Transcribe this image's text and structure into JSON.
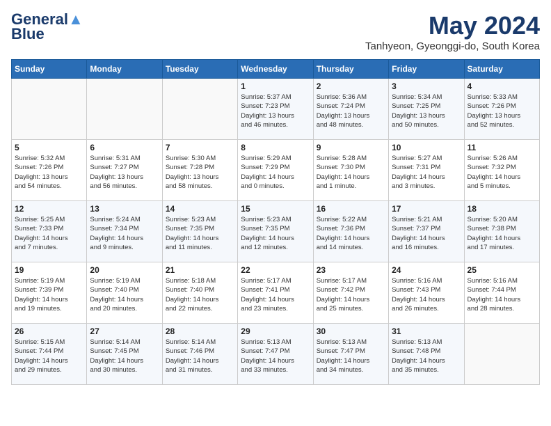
{
  "header": {
    "logo_line1": "General",
    "logo_line2": "Blue",
    "month": "May 2024",
    "location": "Tanhyeon, Gyeonggi-do, South Korea"
  },
  "weekdays": [
    "Sunday",
    "Monday",
    "Tuesday",
    "Wednesday",
    "Thursday",
    "Friday",
    "Saturday"
  ],
  "weeks": [
    [
      {
        "day": "",
        "info": ""
      },
      {
        "day": "",
        "info": ""
      },
      {
        "day": "",
        "info": ""
      },
      {
        "day": "1",
        "info": "Sunrise: 5:37 AM\nSunset: 7:23 PM\nDaylight: 13 hours\nand 46 minutes."
      },
      {
        "day": "2",
        "info": "Sunrise: 5:36 AM\nSunset: 7:24 PM\nDaylight: 13 hours\nand 48 minutes."
      },
      {
        "day": "3",
        "info": "Sunrise: 5:34 AM\nSunset: 7:25 PM\nDaylight: 13 hours\nand 50 minutes."
      },
      {
        "day": "4",
        "info": "Sunrise: 5:33 AM\nSunset: 7:26 PM\nDaylight: 13 hours\nand 52 minutes."
      }
    ],
    [
      {
        "day": "5",
        "info": "Sunrise: 5:32 AM\nSunset: 7:26 PM\nDaylight: 13 hours\nand 54 minutes."
      },
      {
        "day": "6",
        "info": "Sunrise: 5:31 AM\nSunset: 7:27 PM\nDaylight: 13 hours\nand 56 minutes."
      },
      {
        "day": "7",
        "info": "Sunrise: 5:30 AM\nSunset: 7:28 PM\nDaylight: 13 hours\nand 58 minutes."
      },
      {
        "day": "8",
        "info": "Sunrise: 5:29 AM\nSunset: 7:29 PM\nDaylight: 14 hours\nand 0 minutes."
      },
      {
        "day": "9",
        "info": "Sunrise: 5:28 AM\nSunset: 7:30 PM\nDaylight: 14 hours\nand 1 minute."
      },
      {
        "day": "10",
        "info": "Sunrise: 5:27 AM\nSunset: 7:31 PM\nDaylight: 14 hours\nand 3 minutes."
      },
      {
        "day": "11",
        "info": "Sunrise: 5:26 AM\nSunset: 7:32 PM\nDaylight: 14 hours\nand 5 minutes."
      }
    ],
    [
      {
        "day": "12",
        "info": "Sunrise: 5:25 AM\nSunset: 7:33 PM\nDaylight: 14 hours\nand 7 minutes."
      },
      {
        "day": "13",
        "info": "Sunrise: 5:24 AM\nSunset: 7:34 PM\nDaylight: 14 hours\nand 9 minutes."
      },
      {
        "day": "14",
        "info": "Sunrise: 5:23 AM\nSunset: 7:35 PM\nDaylight: 14 hours\nand 11 minutes."
      },
      {
        "day": "15",
        "info": "Sunrise: 5:23 AM\nSunset: 7:35 PM\nDaylight: 14 hours\nand 12 minutes."
      },
      {
        "day": "16",
        "info": "Sunrise: 5:22 AM\nSunset: 7:36 PM\nDaylight: 14 hours\nand 14 minutes."
      },
      {
        "day": "17",
        "info": "Sunrise: 5:21 AM\nSunset: 7:37 PM\nDaylight: 14 hours\nand 16 minutes."
      },
      {
        "day": "18",
        "info": "Sunrise: 5:20 AM\nSunset: 7:38 PM\nDaylight: 14 hours\nand 17 minutes."
      }
    ],
    [
      {
        "day": "19",
        "info": "Sunrise: 5:19 AM\nSunset: 7:39 PM\nDaylight: 14 hours\nand 19 minutes."
      },
      {
        "day": "20",
        "info": "Sunrise: 5:19 AM\nSunset: 7:40 PM\nDaylight: 14 hours\nand 20 minutes."
      },
      {
        "day": "21",
        "info": "Sunrise: 5:18 AM\nSunset: 7:40 PM\nDaylight: 14 hours\nand 22 minutes."
      },
      {
        "day": "22",
        "info": "Sunrise: 5:17 AM\nSunset: 7:41 PM\nDaylight: 14 hours\nand 23 minutes."
      },
      {
        "day": "23",
        "info": "Sunrise: 5:17 AM\nSunset: 7:42 PM\nDaylight: 14 hours\nand 25 minutes."
      },
      {
        "day": "24",
        "info": "Sunrise: 5:16 AM\nSunset: 7:43 PM\nDaylight: 14 hours\nand 26 minutes."
      },
      {
        "day": "25",
        "info": "Sunrise: 5:16 AM\nSunset: 7:44 PM\nDaylight: 14 hours\nand 28 minutes."
      }
    ],
    [
      {
        "day": "26",
        "info": "Sunrise: 5:15 AM\nSunset: 7:44 PM\nDaylight: 14 hours\nand 29 minutes."
      },
      {
        "day": "27",
        "info": "Sunrise: 5:14 AM\nSunset: 7:45 PM\nDaylight: 14 hours\nand 30 minutes."
      },
      {
        "day": "28",
        "info": "Sunrise: 5:14 AM\nSunset: 7:46 PM\nDaylight: 14 hours\nand 31 minutes."
      },
      {
        "day": "29",
        "info": "Sunrise: 5:13 AM\nSunset: 7:47 PM\nDaylight: 14 hours\nand 33 minutes."
      },
      {
        "day": "30",
        "info": "Sunrise: 5:13 AM\nSunset: 7:47 PM\nDaylight: 14 hours\nand 34 minutes."
      },
      {
        "day": "31",
        "info": "Sunrise: 5:13 AM\nSunset: 7:48 PM\nDaylight: 14 hours\nand 35 minutes."
      },
      {
        "day": "",
        "info": ""
      }
    ]
  ]
}
